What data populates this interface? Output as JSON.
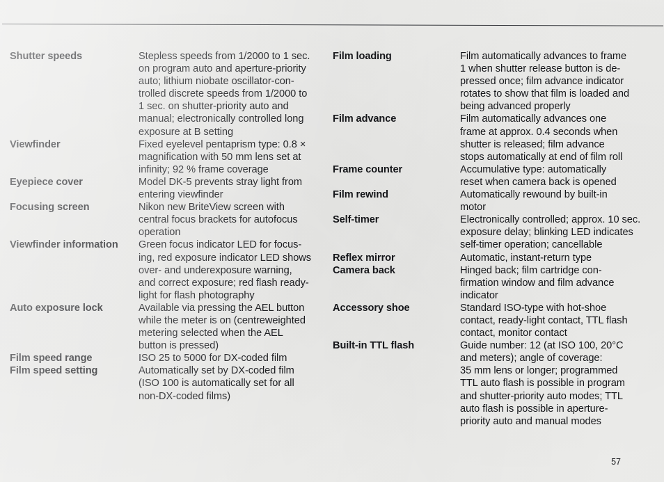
{
  "page": {
    "number": "57"
  },
  "left_column": [
    {
      "label": "Shutter speeds",
      "value": "Stepless speeds from 1/2000 to 1 sec.\non program auto and aperture-priority\nauto; lithium niobate oscillator-con-\ntrolled discrete speeds from 1/2000 to\n1 sec. on shutter-priority auto and\nmanual; electronically controlled long\nexposure at B setting"
    },
    {
      "label": "Viewfinder",
      "value": "Fixed eyelevel pentaprism type: 0.8 ×\nmagnification with 50 mm lens set at\ninfinity; 92 % frame coverage"
    },
    {
      "label": "Eyepiece cover",
      "value": "Model DK-5 prevents stray light from\nentering viewfinder"
    },
    {
      "label": "Focusing screen",
      "value": "Nikon new BriteView screen with\ncentral focus brackets for autofocus\noperation"
    },
    {
      "label": "Viewfinder information",
      "value": "Green focus indicator LED for focus-\ning, red exposure indicator LED shows\nover- and underexposure warning,\nand correct exposure; red flash ready-\nlight for flash photography"
    },
    {
      "label": "Auto exposure lock",
      "value": "Available via pressing the AEL button\nwhile the meter is on (centreweighted\nmetering selected when the AEL\nbutton is pressed)"
    },
    {
      "label": "Film speed range",
      "value": "ISO 25 to 5000 for DX-coded film"
    },
    {
      "label": "Film speed setting",
      "value": "Automatically set by DX-coded film\n(ISO 100 is automatically set for all\nnon-DX-coded films)"
    }
  ],
  "right_column": [
    {
      "label": "Film loading",
      "value": "Film automatically advances to frame\n1 when shutter release button is de-\npressed once; film advance indicator\nrotates to show that film is loaded and\nbeing advanced properly"
    },
    {
      "label": "Film advance",
      "value": "Film automatically advances one\nframe at approx. 0.4 seconds when\nshutter is released; film advance\nstops automatically at end of film roll"
    },
    {
      "label": "Frame counter",
      "value": "Accumulative type: automatically\nreset when camera back is opened"
    },
    {
      "label": "Film rewind",
      "value": "Automatically rewound by built-in\nmotor"
    },
    {
      "label": "Self-timer",
      "value": "Electronically controlled; approx. 10 sec.\nexposure delay; blinking LED indicates\nself-timer operation; cancellable"
    },
    {
      "label": "Reflex mirror",
      "value": "Automatic, instant-return type"
    },
    {
      "label": "Camera back",
      "value": "Hinged back; film cartridge con-\nfirmation window and film advance\nindicator"
    },
    {
      "label": "Accessory shoe",
      "value": "Standard ISO-type with hot-shoe\ncontact, ready-light contact, TTL flash\ncontact, monitor contact"
    },
    {
      "label": "Built-in TTL flash",
      "value": "Guide number: 12 (at ISO 100, 20°C\nand meters); angle of coverage:\n35 mm lens or longer; programmed\nTTL auto flash is possible in program\nand shutter-priority auto modes; TTL\nauto flash is possible in aperture-\npriority auto and manual modes"
    }
  ]
}
